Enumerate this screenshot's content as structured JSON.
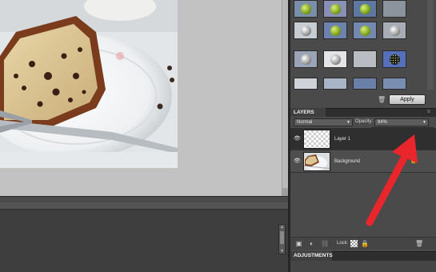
{
  "panels": {
    "layers_title": "LAYERS",
    "adjustments_title": "ADJUSTMENTS"
  },
  "effects": {
    "apply_label": "Apply"
  },
  "layers": {
    "blend_mode": "Normal",
    "opacity_label": "Opacity:",
    "opacity_value": "84%",
    "opacity_slider_level": 0.84,
    "lock_label": "Lock:",
    "items": [
      {
        "name": "Layer 1",
        "selected": true,
        "thumbnail": "transparent"
      },
      {
        "name": "Background",
        "selected": false,
        "thumbnail": "photo"
      }
    ]
  },
  "icons": {
    "visibility": "eye-icon",
    "trash": "trash-icon",
    "lock": "lock-icon",
    "new_layer": "new-layer-icon",
    "adjustment": "adjustment-layer-icon",
    "link": "link-icon",
    "lock_transparent": "lock-transparency-icon",
    "lock_all": "lock-all-icon",
    "panel_menu": "panel-menu-icon"
  },
  "colors": {
    "annotation_arrow": "#e8262b",
    "panel_bg": "#4a4a4a",
    "selected_row": "#2f2f2f",
    "workspace": "#c2c2c2"
  }
}
